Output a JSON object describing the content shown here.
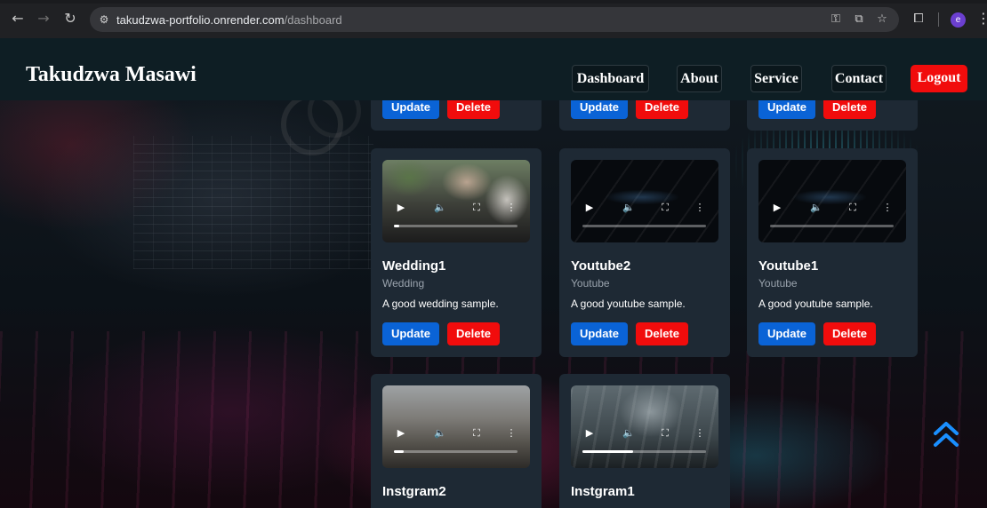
{
  "browser": {
    "url_host": "takudzwa-portfolio.onrender.com",
    "url_path": "/dashboard",
    "profile_initial": "e",
    "icons": {
      "back": "arrow-left-icon",
      "forward": "arrow-right-icon",
      "reload": "reload-icon",
      "site_info": "site-info-icon",
      "password": "key-icon",
      "install": "install-app-icon",
      "bookmark": "star-icon",
      "extensions": "puzzle-icon",
      "menu": "more-vertical-icon"
    }
  },
  "header": {
    "brand": "Takudzwa Masawi",
    "nav": [
      {
        "label": "Dashboard"
      },
      {
        "label": "About"
      },
      {
        "label": "Service"
      },
      {
        "label": "Contact"
      }
    ],
    "logout_label": "Logout"
  },
  "colors": {
    "header_bg": "#0e1e24",
    "card_bg": "#1e2934",
    "update_button": "#0a63d6",
    "delete_button": "#f10c0c",
    "scroll_top_icon": "#1a8fff"
  },
  "buttons": {
    "update": "Update",
    "delete": "Delete"
  },
  "cards": [
    {
      "title": "Wedding1",
      "category": "Wedding",
      "description": "A good wedding sample.",
      "progress": 0.04
    },
    {
      "title": "Youtube2",
      "category": "Youtube",
      "description": "A good youtube sample.",
      "progress": 0
    },
    {
      "title": "Youtube1",
      "category": "Youtube",
      "description": "A good youtube sample.",
      "progress": 0
    },
    {
      "title": "Instgram2",
      "category": "",
      "description": "",
      "progress": 0.08
    },
    {
      "title": "Instgram1",
      "category": "",
      "description": "",
      "progress": 0.41
    }
  ]
}
